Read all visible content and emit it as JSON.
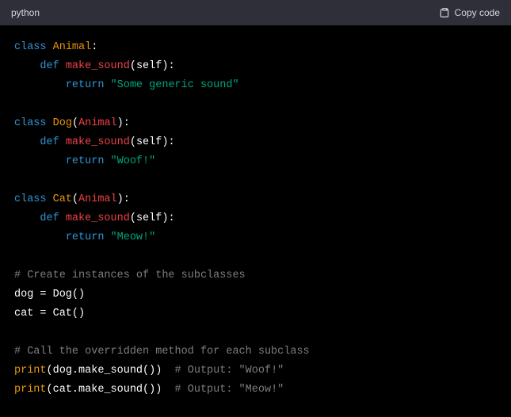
{
  "header": {
    "language": "python",
    "copy_label": "Copy code"
  },
  "code": {
    "kw_class": "class",
    "kw_def": "def",
    "kw_return": "return",
    "animal": "Animal",
    "dog": "Dog",
    "cat": "Cat",
    "make_sound": "make_sound",
    "self": "self",
    "str_generic": "\"Some generic sound\"",
    "str_woof": "\"Woof!\"",
    "str_meow": "\"Meow!\"",
    "comment_create": "# Create instances of the subclasses",
    "var_dog": "dog = Dog()",
    "var_cat": "cat = Cat()",
    "comment_call": "# Call the overridden method for each subclass",
    "print": "print",
    "dog_call": "(dog.make_sound())",
    "cat_call": "(cat.make_sound())",
    "comment_out_woof": "# Output: \"Woof!\"",
    "comment_out_meow": "# Output: \"Meow!\""
  }
}
